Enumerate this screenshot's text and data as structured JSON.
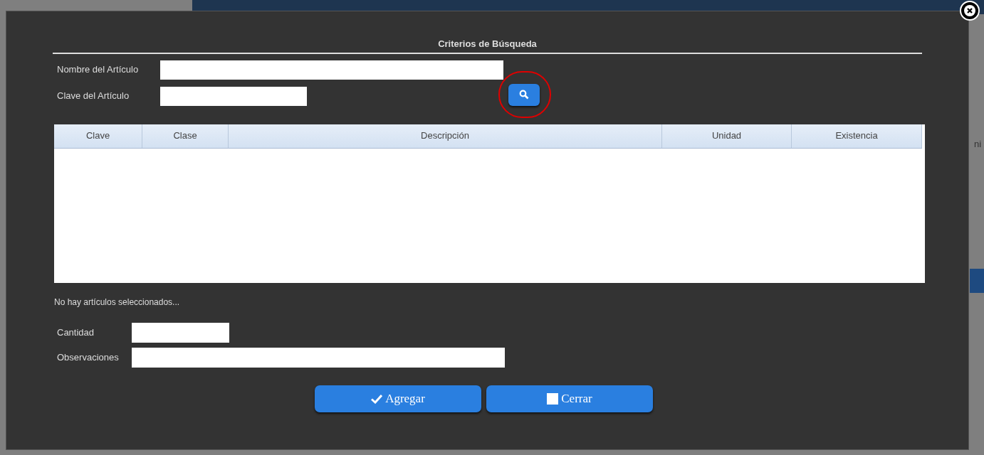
{
  "background": {
    "edge_text": "ni"
  },
  "dialog": {
    "section_title": "Criterios de Búsqueda",
    "search_fields": [
      {
        "label": "Nombre del Artículo",
        "kind": "wide"
      },
      {
        "label": "Clave del Artículo",
        "kind": "narrow"
      }
    ],
    "table": {
      "columns": [
        "Clave",
        "Clase",
        "Descripción",
        "Unidad",
        "Existencia"
      ]
    },
    "status_message": "No hay artículos seleccionados...",
    "detail_fields": [
      {
        "label": "Cantidad",
        "kind": "narrow"
      },
      {
        "label": "Observaciones",
        "kind": "wide"
      }
    ],
    "buttons": [
      {
        "label": "Agregar",
        "kind": "check"
      },
      {
        "label": "Cerrar",
        "kind": "square"
      }
    ]
  }
}
